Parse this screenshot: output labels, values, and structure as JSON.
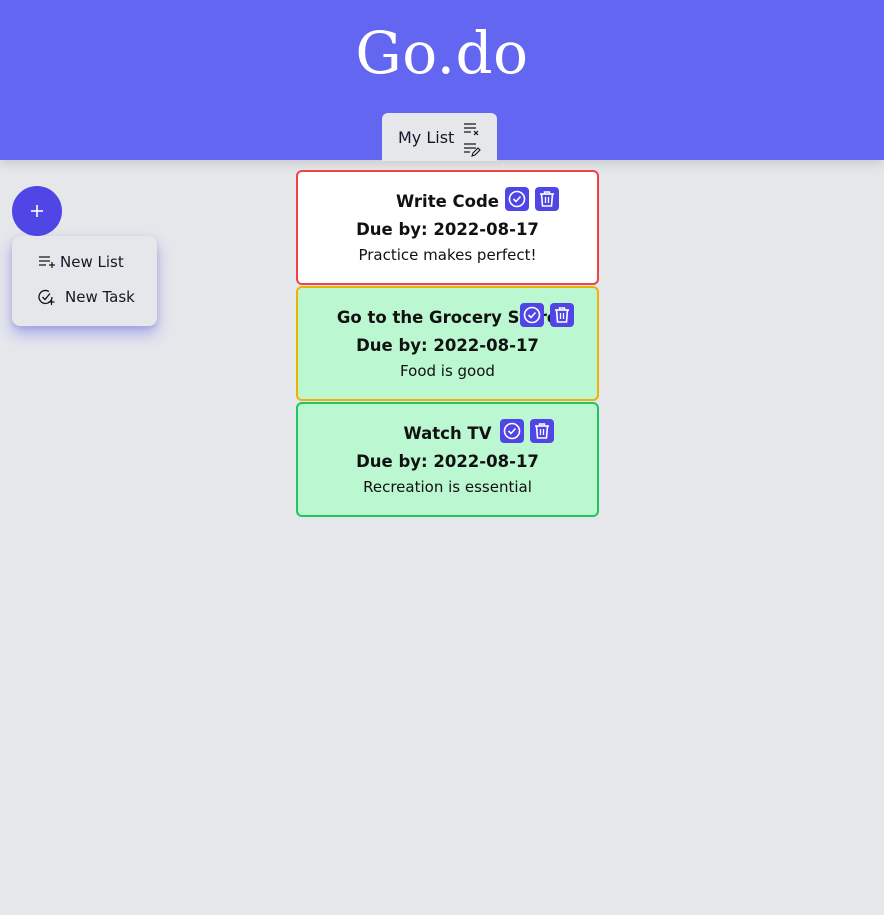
{
  "app": {
    "title": "Go.do",
    "colors": {
      "header": "#6366f1",
      "accent": "#4f46e5",
      "background": "#e5e7eb"
    }
  },
  "tabs": [
    {
      "label": "My List",
      "icons": [
        "clear-list-icon",
        "edit-list-icon"
      ]
    }
  ],
  "fab": {
    "label": "+",
    "icon": "plus-icon"
  },
  "menu": {
    "items": [
      {
        "label": "New List",
        "icon": "add-list-icon"
      },
      {
        "label": "New Task",
        "icon": "add-task-icon"
      }
    ]
  },
  "tasks": [
    {
      "title": "Write Code",
      "due": "Due by: 2022-08-17",
      "description": "Practice makes perfect!",
      "border_color": "#ef4444",
      "background": "#ffffff",
      "actions": [
        "complete-icon",
        "delete-icon"
      ]
    },
    {
      "title": "Go to the Grocery Store",
      "due": "Due by: 2022-08-17",
      "description": "Food is good",
      "border_color": "#eab308",
      "background": "#bbf7d0",
      "actions": [
        "complete-icon",
        "delete-icon"
      ]
    },
    {
      "title": "Watch TV",
      "due": "Due by: 2022-08-17",
      "description": "Recreation is essential",
      "border_color": "#22c55e",
      "background": "#bbf7d0",
      "actions": [
        "complete-icon",
        "delete-icon"
      ]
    }
  ]
}
